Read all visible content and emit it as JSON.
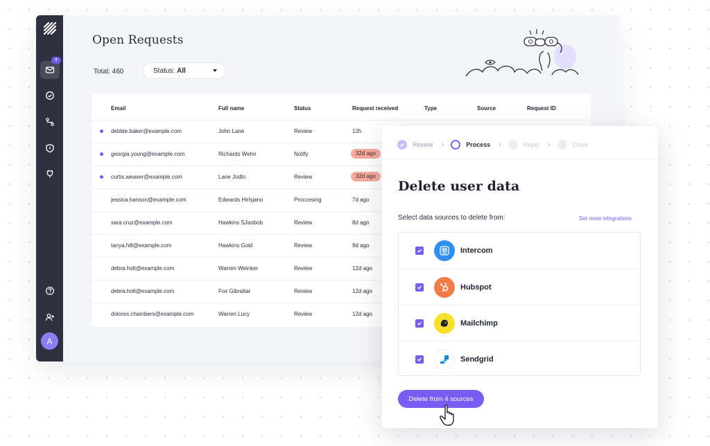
{
  "colors": {
    "accent": "#7b5cf2",
    "sidebar": "#2f3140",
    "badge": "#6e5cf0",
    "pill": "#f5aa9b"
  },
  "sidebar": {
    "logo_icon": "stripes-logo-icon",
    "items": [
      {
        "name": "inbox-icon",
        "badge": "4",
        "active": true
      },
      {
        "name": "check-circle-icon"
      },
      {
        "name": "flow-icon"
      },
      {
        "name": "shield-icon"
      },
      {
        "name": "plug-icon"
      }
    ],
    "bottom": [
      {
        "name": "help-icon"
      },
      {
        "name": "add-user-icon"
      }
    ],
    "avatar": "A"
  },
  "header": {
    "title": "Open Requests",
    "total": "Total: 460",
    "filter_label": "Status:",
    "filter_value": "All"
  },
  "table": {
    "columns": {
      "email": "Email",
      "full_name": "Full name",
      "status": "Status",
      "request_received": "Request received",
      "type": "Type",
      "source": "Source",
      "request_id": "Request ID"
    },
    "rows": [
      {
        "unread": true,
        "email": "debbie.baker@example.com",
        "name": "John Lane",
        "status": "Review",
        "received": "12h",
        "highlight": false
      },
      {
        "unread": true,
        "email": "georgia.young@example.com",
        "name": "Richards Wehn",
        "status": "Notify",
        "received": "32d ago",
        "highlight": true
      },
      {
        "unread": true,
        "email": "curtis.weaver@example.com",
        "name": "Lane Jodlo",
        "status": "Review",
        "received": "32d ago",
        "highlight": true
      },
      {
        "unread": false,
        "email": "jessica.hanson@example.com",
        "name": "Edwards Hirlsjano",
        "status": "Proccesing",
        "received": "7d ago",
        "highlight": false
      },
      {
        "unread": false,
        "email": "sara.cruz@example.com",
        "name": "Hawkins SJaobob",
        "status": "Review",
        "received": "8d ago",
        "highlight": false
      },
      {
        "unread": false,
        "email": "tanya.hill@example.com",
        "name": "Hawkins Gold",
        "status": "Review",
        "received": "9d ago",
        "highlight": false
      },
      {
        "unread": false,
        "email": "debra.holt@example.com",
        "name": "Warren Weinker",
        "status": "Review",
        "received": "12d ago",
        "highlight": false
      },
      {
        "unread": false,
        "email": "debra.holt@example.com",
        "name": "Fox Gibraltar",
        "status": "Review",
        "received": "12d ago",
        "highlight": false
      },
      {
        "unread": false,
        "email": "dolores.chambers@example.com",
        "name": "Warren Lucy",
        "status": "Review",
        "received": "12d ago",
        "highlight": false
      }
    ]
  },
  "modal": {
    "steps": [
      {
        "label": "Review",
        "state": "done"
      },
      {
        "label": "Process",
        "state": "current"
      },
      {
        "label": "Reply",
        "state": "todo"
      },
      {
        "label": "Close",
        "state": "todo"
      }
    ],
    "title": "Delete user data",
    "subtitle": "Select data sources to delete from:",
    "link": "Set more integrations",
    "sources": [
      {
        "name": "Intercom",
        "checked": true,
        "icon": "intercom-icon"
      },
      {
        "name": "Hubspot",
        "checked": true,
        "icon": "hubspot-icon"
      },
      {
        "name": "Mailchimp",
        "checked": true,
        "icon": "mailchimp-icon"
      },
      {
        "name": "Sendgrid",
        "checked": true,
        "icon": "sendgrid-icon"
      }
    ],
    "button": "Delete from 4 sources",
    "cursor_icon": "hand-pointer-icon"
  }
}
